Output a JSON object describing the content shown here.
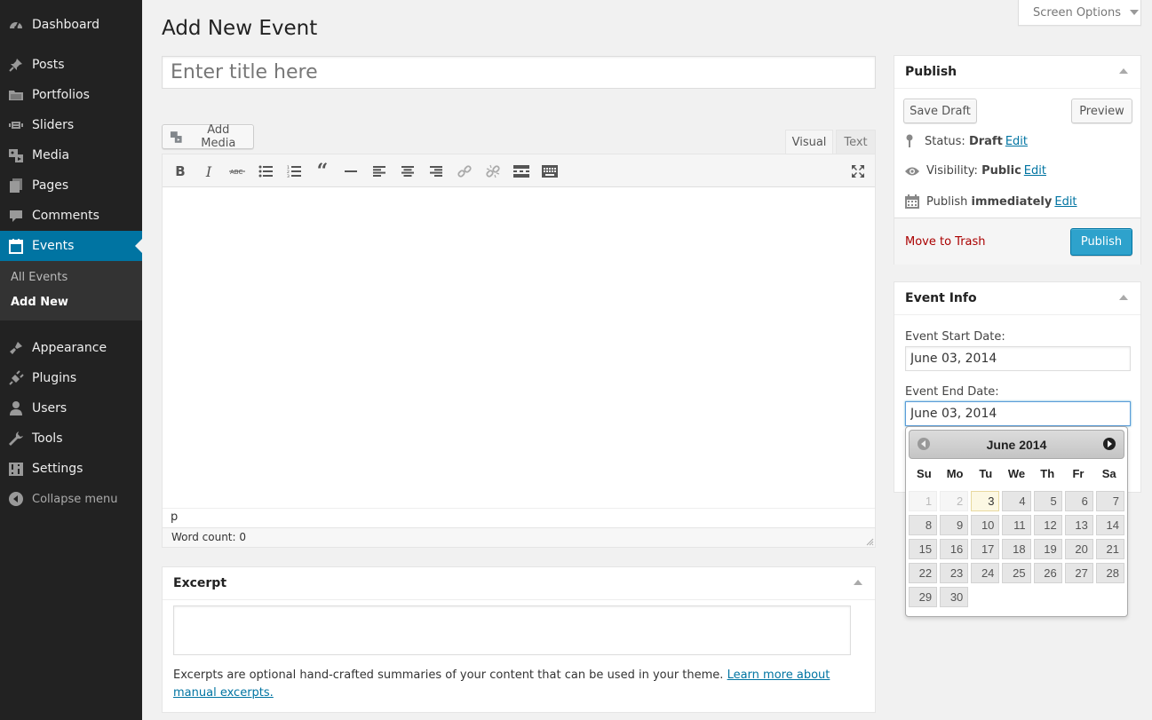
{
  "sidebar": {
    "items": [
      {
        "label": "Dashboard",
        "icon": "dashboard-icon"
      },
      {
        "label": "Posts",
        "icon": "pushpin-icon"
      },
      {
        "label": "Portfolios",
        "icon": "folder-icon"
      },
      {
        "label": "Sliders",
        "icon": "slider-icon"
      },
      {
        "label": "Media",
        "icon": "media-icon"
      },
      {
        "label": "Pages",
        "icon": "pages-icon"
      },
      {
        "label": "Comments",
        "icon": "comment-icon"
      },
      {
        "label": "Events",
        "icon": "calendar-icon"
      },
      {
        "label": "Appearance",
        "icon": "paintbrush-icon"
      },
      {
        "label": "Plugins",
        "icon": "plugin-icon"
      },
      {
        "label": "Users",
        "icon": "user-icon"
      },
      {
        "label": "Tools",
        "icon": "wrench-icon"
      },
      {
        "label": "Settings",
        "icon": "settings-icon"
      }
    ],
    "submenu": {
      "all_events": "All Events",
      "add_new": "Add New"
    },
    "collapse": "Collapse menu"
  },
  "screen_options": "Screen Options",
  "page": {
    "title": "Add New Event",
    "title_placeholder": "Enter title here"
  },
  "editor": {
    "add_media": "Add Media",
    "tab_visual": "Visual",
    "tab_text": "Text",
    "toolbar": [
      "bold",
      "italic",
      "strikethrough",
      "bullet-list",
      "numbered-list",
      "blockquote",
      "horizontal-rule",
      "align-left",
      "align-center",
      "align-right",
      "insert-link",
      "remove-link",
      "read-more",
      "toolbar-toggle",
      "fullscreen"
    ],
    "path": "p",
    "word_count": "Word count: 0"
  },
  "excerpt": {
    "title": "Excerpt",
    "help": "Excerpts are optional hand-crafted summaries of your content that can be used in your theme. ",
    "help_link": "Learn more about manual excerpts."
  },
  "publish": {
    "title": "Publish",
    "save_draft": "Save Draft",
    "preview": "Preview",
    "status_label": "Status:",
    "status_value": "Draft",
    "visibility_label": "Visibility:",
    "visibility_value": "Public",
    "publish_label": "Publish",
    "publish_value": "immediately",
    "edit": "Edit",
    "move_to_trash": "Move to Trash",
    "publish_button": "Publish",
    "colors": {
      "primary": "#2ea2cc",
      "trash": "#aa0000"
    }
  },
  "event_info": {
    "title": "Event Info",
    "start_label": "Event Start Date:",
    "start_value": "June 03, 2014",
    "end_label": "Event End Date:",
    "end_value": "June 03, 2014"
  },
  "datepicker": {
    "month_label": "June 2014",
    "dows": [
      "Su",
      "Mo",
      "Tu",
      "We",
      "Th",
      "Fr",
      "Sa"
    ],
    "disabled_days": [
      1,
      2
    ],
    "today": 3,
    "days": [
      1,
      2,
      3,
      4,
      5,
      6,
      7,
      8,
      9,
      10,
      11,
      12,
      13,
      14,
      15,
      16,
      17,
      18,
      19,
      20,
      21,
      22,
      23,
      24,
      25,
      26,
      27,
      28,
      29,
      30
    ]
  },
  "colors": {
    "sidebar_bg": "#222222",
    "active_menu": "#0074a2",
    "link": "#0074a2"
  }
}
